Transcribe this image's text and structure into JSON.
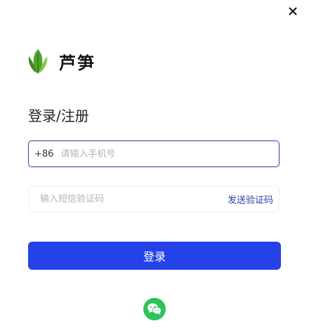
{
  "window": {
    "close_icon": "close-icon"
  },
  "logo": {
    "icon": "leaf-icon",
    "text": "芦笋"
  },
  "form": {
    "heading": "登录/注册",
    "phone": {
      "country_code": "+86",
      "placeholder": "请输入手机号",
      "value": ""
    },
    "code": {
      "placeholder": "输入短信验证码",
      "value": "",
      "send_label": "发送验证码"
    },
    "login_label": "登录",
    "wechat_icon": "wechat-icon"
  },
  "colors": {
    "primary": "#2541e8",
    "link": "#2b3ea8",
    "wechat": "#2dc35a",
    "leaf_dark": "#3a8a1e",
    "leaf_light": "#8dc63f"
  }
}
